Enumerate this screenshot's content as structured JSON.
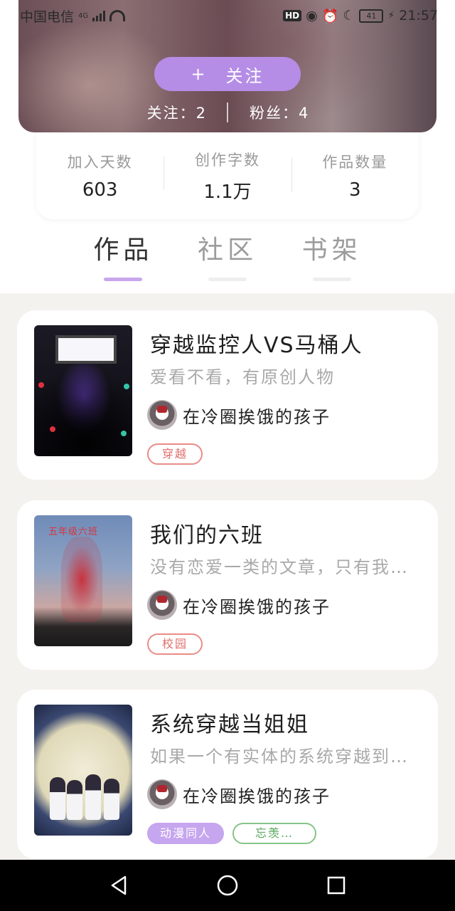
{
  "status_bar": {
    "carrier": "中国电信",
    "network": "4G",
    "hd": "HD",
    "battery": "41",
    "time": "21:57"
  },
  "profile": {
    "follow_button": {
      "icon": "+",
      "label": "关注"
    },
    "following_label": "关注：",
    "following_count": "2",
    "fans_label": "粉丝：",
    "fans_count": "4"
  },
  "stats": [
    {
      "label": "加入天数",
      "value": "603"
    },
    {
      "label": "创作字数",
      "value": "1.1万"
    },
    {
      "label": "作品数量",
      "value": "3"
    }
  ],
  "tabs": [
    {
      "label": "作品",
      "active": true
    },
    {
      "label": "社区",
      "active": false
    },
    {
      "label": "书架",
      "active": false
    }
  ],
  "works": [
    {
      "title": "穿越监控人VS马桶人",
      "description": "爱看不看，有原创人物",
      "author": "在冷圈挨饿的孩子",
      "tags": [
        "穿越"
      ]
    },
    {
      "title": "我们的六班",
      "description": "没有恋爱一类的文章，只有我…",
      "author": "在冷圈挨饿的孩子",
      "tags": [
        "校园"
      ],
      "cover_text": "五年级六班"
    },
    {
      "title": "系统穿越当姐姐",
      "description": "如果一个有实体的系统穿越到…",
      "author": "在冷圈挨饿的孩子",
      "tags": [
        "动漫同人",
        "忘羡…"
      ]
    }
  ],
  "colors": {
    "accent": "#b58de6",
    "tab_indicator": "#c7a6ec",
    "tag_red": "#e06d6a",
    "tag_green": "#5aa75c"
  },
  "icons": {
    "back": "back-triangle-icon",
    "home": "home-circle-icon",
    "recents": "recents-square-icon"
  }
}
